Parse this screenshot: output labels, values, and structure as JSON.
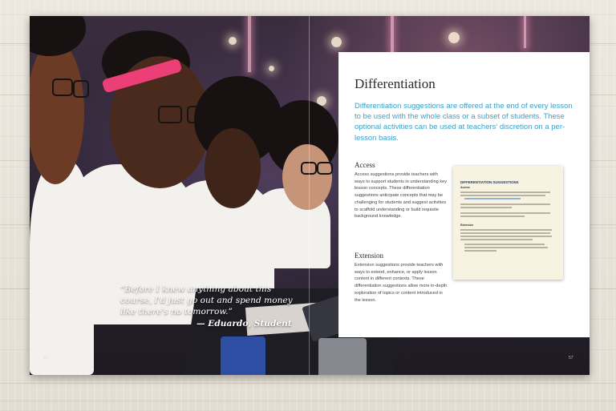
{
  "right_page": {
    "title": "Differentiation",
    "intro": "Differentiation suggestions are offered at the end of every lesson to be used with the whole class or a subset of students. These optional activities can be used at teachers' discretion on a per-lesson basis.",
    "access_heading": "Access",
    "access_body": "Access suggestions provide teachers with ways to support students in understanding key lesson concepts. These differentiation suggestions anticipate concepts that may be challenging for students and suggest activities to scaffold understanding or build requisite background knowledge.",
    "extension_heading": "Extension",
    "extension_body": "Extension suggestions provide teachers with ways to extend, enhance, or apply lesson content in different contexts. These differentiation suggestions allow more in-depth exploration of topics or content introduced in the lesson."
  },
  "worksheet": {
    "title": "DIFFERENTIATION SUGGESTIONS",
    "access_label": "Access",
    "extension_label": "Extension"
  },
  "quote": {
    "text": "“Before I knew anything about this course, I'd just go out and spend money like there's no tomorrow.”",
    "attribution": "— Eduardo, Student"
  },
  "page_numbers": {
    "left": "56",
    "right": "57"
  }
}
